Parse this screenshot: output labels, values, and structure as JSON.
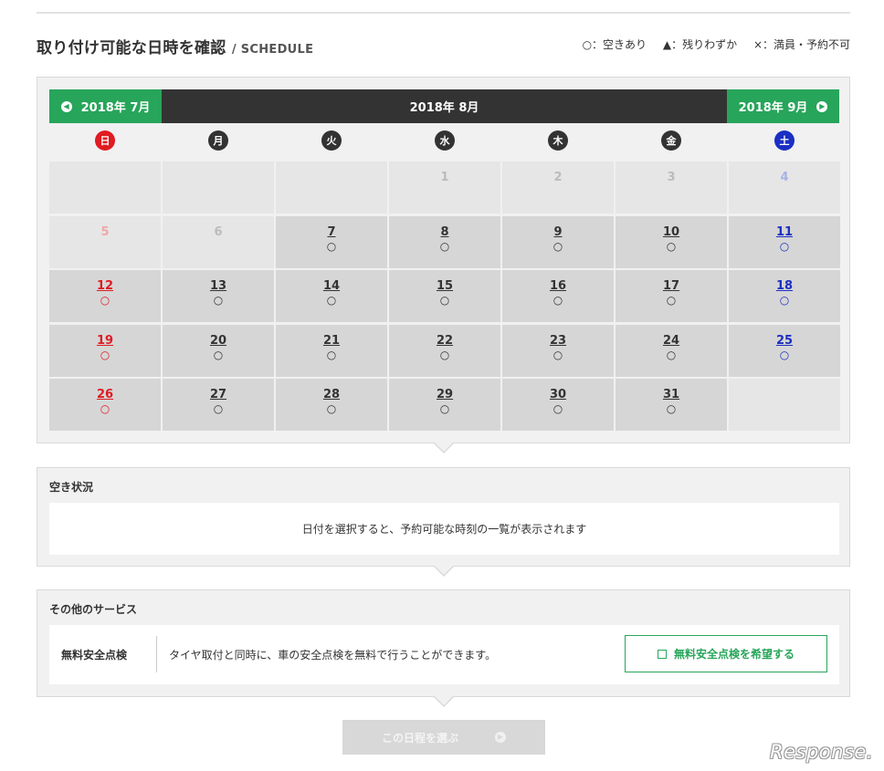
{
  "header": {
    "title": "取り付け可能な日時を確認",
    "subtitle": "/ SCHEDULE"
  },
  "legend": {
    "available": "○：空きあり",
    "few_left": "▲：残りわずか",
    "full": "×：満員・予約不可"
  },
  "calendar": {
    "prev_month": "2018年 7月",
    "current_month": "2018年 8月",
    "next_month": "2018年 9月",
    "weekdays": [
      "日",
      "月",
      "火",
      "水",
      "木",
      "金",
      "土"
    ],
    "colors": {
      "sunday": "#e01b22",
      "saturday": "#1b2fc2",
      "nav": "#27a55a",
      "header": "#333333"
    },
    "weeks": [
      [
        null,
        null,
        null,
        {
          "day": "1",
          "mark": "",
          "off": true
        },
        {
          "day": "2",
          "mark": "",
          "off": true
        },
        {
          "day": "3",
          "mark": "",
          "off": true
        },
        {
          "day": "4",
          "mark": "",
          "off": true
        }
      ],
      [
        {
          "day": "5",
          "mark": "",
          "off": true
        },
        {
          "day": "6",
          "mark": "",
          "off": true
        },
        {
          "day": "7",
          "mark": "○"
        },
        {
          "day": "8",
          "mark": "○"
        },
        {
          "day": "9",
          "mark": "○"
        },
        {
          "day": "10",
          "mark": "○"
        },
        {
          "day": "11",
          "mark": "○"
        }
      ],
      [
        {
          "day": "12",
          "mark": "○"
        },
        {
          "day": "13",
          "mark": "○"
        },
        {
          "day": "14",
          "mark": "○"
        },
        {
          "day": "15",
          "mark": "○"
        },
        {
          "day": "16",
          "mark": "○"
        },
        {
          "day": "17",
          "mark": "○"
        },
        {
          "day": "18",
          "mark": "○"
        }
      ],
      [
        {
          "day": "19",
          "mark": "○"
        },
        {
          "day": "20",
          "mark": "○"
        },
        {
          "day": "21",
          "mark": "○"
        },
        {
          "day": "22",
          "mark": "○"
        },
        {
          "day": "23",
          "mark": "○"
        },
        {
          "day": "24",
          "mark": "○"
        },
        {
          "day": "25",
          "mark": "○"
        }
      ],
      [
        {
          "day": "26",
          "mark": "○"
        },
        {
          "day": "27",
          "mark": "○"
        },
        {
          "day": "28",
          "mark": "○"
        },
        {
          "day": "29",
          "mark": "○"
        },
        {
          "day": "30",
          "mark": "○"
        },
        {
          "day": "31",
          "mark": "○"
        },
        null
      ]
    ]
  },
  "availability": {
    "heading": "空き状況",
    "message": "日付を選択すると、予約可能な時刻の一覧が表示されます"
  },
  "services": {
    "heading": "その他のサービス",
    "name": "無料安全点検",
    "description": "タイヤ取付と同時に、車の安全点検を無料で行うことができます。",
    "button_label": "無料安全点検を希望する"
  },
  "submit": {
    "label": "この日程を選ぶ"
  },
  "watermark": "Response."
}
